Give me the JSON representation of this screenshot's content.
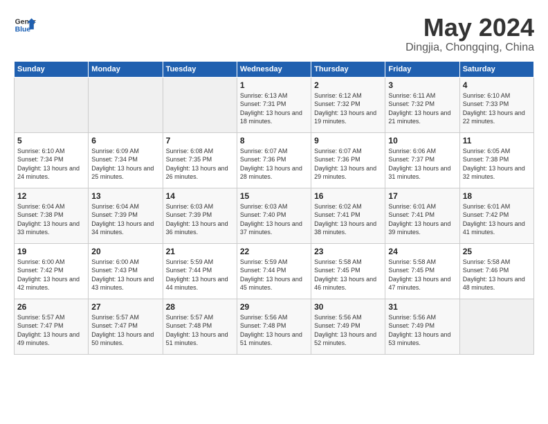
{
  "header": {
    "logo_line1": "General",
    "logo_line2": "Blue",
    "title": "May 2024",
    "subtitle": "Dingjia, Chongqing, China"
  },
  "calendar": {
    "days_of_week": [
      "Sunday",
      "Monday",
      "Tuesday",
      "Wednesday",
      "Thursday",
      "Friday",
      "Saturday"
    ],
    "weeks": [
      [
        {
          "day": "",
          "info": ""
        },
        {
          "day": "",
          "info": ""
        },
        {
          "day": "",
          "info": ""
        },
        {
          "day": "1",
          "info": "Sunrise: 6:13 AM\nSunset: 7:31 PM\nDaylight: 13 hours and 18 minutes."
        },
        {
          "day": "2",
          "info": "Sunrise: 6:12 AM\nSunset: 7:32 PM\nDaylight: 13 hours and 19 minutes."
        },
        {
          "day": "3",
          "info": "Sunrise: 6:11 AM\nSunset: 7:32 PM\nDaylight: 13 hours and 21 minutes."
        },
        {
          "day": "4",
          "info": "Sunrise: 6:10 AM\nSunset: 7:33 PM\nDaylight: 13 hours and 22 minutes."
        }
      ],
      [
        {
          "day": "5",
          "info": "Sunrise: 6:10 AM\nSunset: 7:34 PM\nDaylight: 13 hours and 24 minutes."
        },
        {
          "day": "6",
          "info": "Sunrise: 6:09 AM\nSunset: 7:34 PM\nDaylight: 13 hours and 25 minutes."
        },
        {
          "day": "7",
          "info": "Sunrise: 6:08 AM\nSunset: 7:35 PM\nDaylight: 13 hours and 26 minutes."
        },
        {
          "day": "8",
          "info": "Sunrise: 6:07 AM\nSunset: 7:36 PM\nDaylight: 13 hours and 28 minutes."
        },
        {
          "day": "9",
          "info": "Sunrise: 6:07 AM\nSunset: 7:36 PM\nDaylight: 13 hours and 29 minutes."
        },
        {
          "day": "10",
          "info": "Sunrise: 6:06 AM\nSunset: 7:37 PM\nDaylight: 13 hours and 31 minutes."
        },
        {
          "day": "11",
          "info": "Sunrise: 6:05 AM\nSunset: 7:38 PM\nDaylight: 13 hours and 32 minutes."
        }
      ],
      [
        {
          "day": "12",
          "info": "Sunrise: 6:04 AM\nSunset: 7:38 PM\nDaylight: 13 hours and 33 minutes."
        },
        {
          "day": "13",
          "info": "Sunrise: 6:04 AM\nSunset: 7:39 PM\nDaylight: 13 hours and 34 minutes."
        },
        {
          "day": "14",
          "info": "Sunrise: 6:03 AM\nSunset: 7:39 PM\nDaylight: 13 hours and 36 minutes."
        },
        {
          "day": "15",
          "info": "Sunrise: 6:03 AM\nSunset: 7:40 PM\nDaylight: 13 hours and 37 minutes."
        },
        {
          "day": "16",
          "info": "Sunrise: 6:02 AM\nSunset: 7:41 PM\nDaylight: 13 hours and 38 minutes."
        },
        {
          "day": "17",
          "info": "Sunrise: 6:01 AM\nSunset: 7:41 PM\nDaylight: 13 hours and 39 minutes."
        },
        {
          "day": "18",
          "info": "Sunrise: 6:01 AM\nSunset: 7:42 PM\nDaylight: 13 hours and 41 minutes."
        }
      ],
      [
        {
          "day": "19",
          "info": "Sunrise: 6:00 AM\nSunset: 7:42 PM\nDaylight: 13 hours and 42 minutes."
        },
        {
          "day": "20",
          "info": "Sunrise: 6:00 AM\nSunset: 7:43 PM\nDaylight: 13 hours and 43 minutes."
        },
        {
          "day": "21",
          "info": "Sunrise: 5:59 AM\nSunset: 7:44 PM\nDaylight: 13 hours and 44 minutes."
        },
        {
          "day": "22",
          "info": "Sunrise: 5:59 AM\nSunset: 7:44 PM\nDaylight: 13 hours and 45 minutes."
        },
        {
          "day": "23",
          "info": "Sunrise: 5:58 AM\nSunset: 7:45 PM\nDaylight: 13 hours and 46 minutes."
        },
        {
          "day": "24",
          "info": "Sunrise: 5:58 AM\nSunset: 7:45 PM\nDaylight: 13 hours and 47 minutes."
        },
        {
          "day": "25",
          "info": "Sunrise: 5:58 AM\nSunset: 7:46 PM\nDaylight: 13 hours and 48 minutes."
        }
      ],
      [
        {
          "day": "26",
          "info": "Sunrise: 5:57 AM\nSunset: 7:47 PM\nDaylight: 13 hours and 49 minutes."
        },
        {
          "day": "27",
          "info": "Sunrise: 5:57 AM\nSunset: 7:47 PM\nDaylight: 13 hours and 50 minutes."
        },
        {
          "day": "28",
          "info": "Sunrise: 5:57 AM\nSunset: 7:48 PM\nDaylight: 13 hours and 51 minutes."
        },
        {
          "day": "29",
          "info": "Sunrise: 5:56 AM\nSunset: 7:48 PM\nDaylight: 13 hours and 51 minutes."
        },
        {
          "day": "30",
          "info": "Sunrise: 5:56 AM\nSunset: 7:49 PM\nDaylight: 13 hours and 52 minutes."
        },
        {
          "day": "31",
          "info": "Sunrise: 5:56 AM\nSunset: 7:49 PM\nDaylight: 13 hours and 53 minutes."
        },
        {
          "day": "",
          "info": ""
        }
      ]
    ]
  }
}
